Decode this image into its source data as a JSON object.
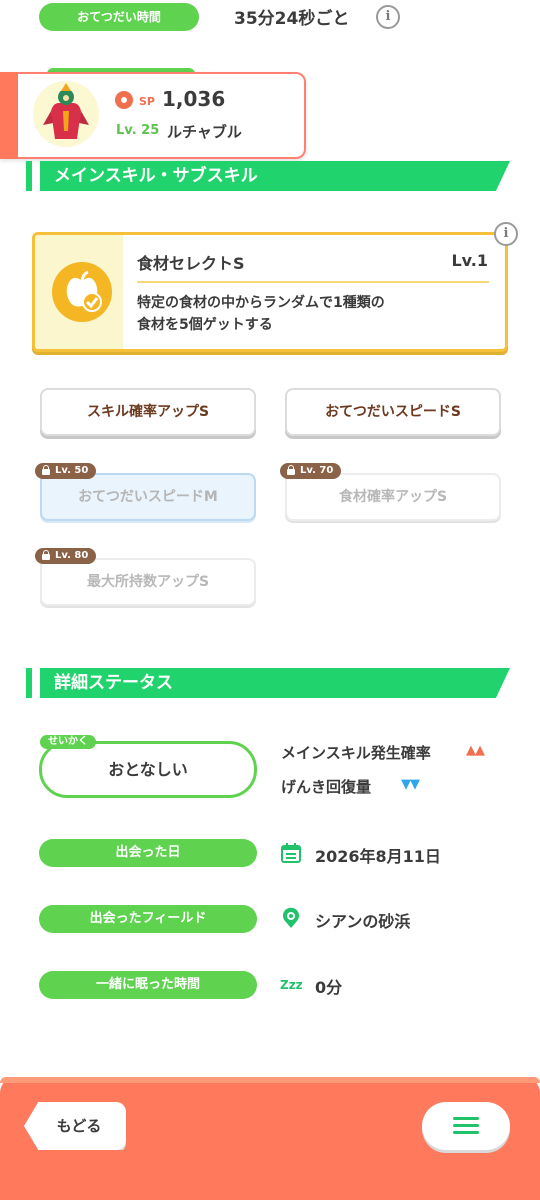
{
  "header": {
    "interval_label": "おてつだい時間",
    "interval_value": "35分24秒ごと",
    "info_glyph": "i"
  },
  "pokemon": {
    "sp_label": "SP",
    "sp_value": "1,036",
    "level": "Lv. 25",
    "name": "ルチャブル"
  },
  "skills_section": {
    "title": "メインスキル・サブスキル",
    "main_skill": {
      "name": "食材セレクトS",
      "level": "Lv.1",
      "description_line1": "特定の食材の中からランダムで1種類の",
      "description_line2": "食材を5個ゲットする",
      "icon": "apple-check-icon"
    },
    "sub_skills": [
      {
        "label": "スキル確率アップS",
        "lock": ""
      },
      {
        "label": "おてつだいスピードS",
        "lock": ""
      },
      {
        "label": "おてつだいスピードM",
        "lock": "Lv. 50"
      },
      {
        "label": "食材確率アップS",
        "lock": "Lv. 70"
      },
      {
        "label": "最大所持数アップS",
        "lock": "Lv. 80"
      }
    ]
  },
  "details_section": {
    "title": "詳細ステータス",
    "nature_tag": "せいかく",
    "nature": "おとなしい",
    "nature_up": "メインスキル発生確率",
    "nature_up_arrows": "▲▲",
    "nature_down": "げんき回復量",
    "nature_down_arrows": "▼▼",
    "met_date_label": "出会った日",
    "met_date": "2026年8月11日",
    "met_field_label": "出会ったフィールド",
    "met_field": "シアンの砂浜",
    "sleep_label": "一緒に眠った時間",
    "sleep_value": "0分",
    "sleep_icon_text": "Zzz"
  },
  "footer": {
    "back_label": "もどる",
    "menu_icon": "hamburger-menu-icon"
  },
  "colors": {
    "green": "#5fd24f",
    "section_green": "#20d36c",
    "coral": "#ff7a5c",
    "skill_gold": "#f6c13a"
  }
}
